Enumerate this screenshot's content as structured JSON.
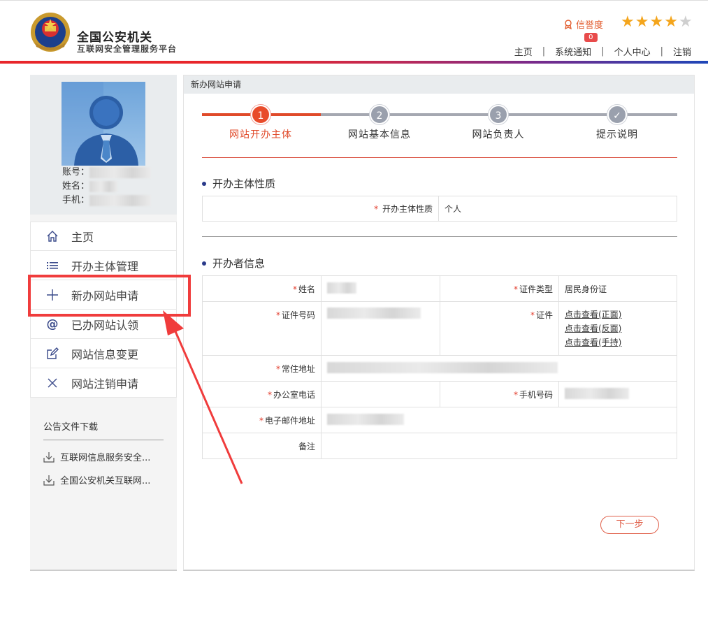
{
  "header": {
    "title": "全国公安机关",
    "subtitle": "互联网安全管理服务平台",
    "credit_label": "信誉度",
    "stars": {
      "filled": 4,
      "total": 5
    },
    "nav": {
      "home": "主页",
      "notifications": "系统通知",
      "notification_count": "0",
      "profile": "个人中心",
      "logout": "注销"
    }
  },
  "sidebar": {
    "profile": {
      "account_label": "账号：",
      "name_label": "姓名：",
      "phone_label": "手机："
    },
    "menu": [
      {
        "label": "主页",
        "icon": "home-icon"
      },
      {
        "label": "开办主体管理",
        "icon": "list-icon"
      },
      {
        "label": "新办网站申请",
        "icon": "plus-icon"
      },
      {
        "label": "已办网站认领",
        "icon": "at-icon"
      },
      {
        "label": "网站信息变更",
        "icon": "edit-icon"
      },
      {
        "label": "网站注销申请",
        "icon": "close-icon"
      }
    ],
    "downloads": {
      "title": "公告文件下载",
      "items": [
        "互联网信息服务安全...",
        "全国公安机关互联网..."
      ]
    }
  },
  "main": {
    "breadcrumb": "新办网站申请",
    "steps": [
      {
        "num": "1",
        "label": "网站开办主体",
        "active": true
      },
      {
        "num": "2",
        "label": "网站基本信息",
        "active": false
      },
      {
        "num": "3",
        "label": "网站负责人",
        "active": false
      },
      {
        "num": "✓",
        "label": "提示说明",
        "active": false
      }
    ],
    "entity_section": {
      "title": "开办主体性质",
      "label": "开办主体性质",
      "value": "个人"
    },
    "owner_section": {
      "title": "开办者信息",
      "name_label": "姓名",
      "id_type_label": "证件类型",
      "id_type_value": "居民身份证",
      "id_number_label": "证件号码",
      "id_doc_label": "证件",
      "id_links": [
        "点击查看(正面)",
        "点击查看(反面)",
        "点击查看(手持)"
      ],
      "address_label": "常住地址",
      "office_phone_label": "办公室电话",
      "mobile_label": "手机号码",
      "email_label": "电子邮件地址",
      "remarks_label": "备注"
    },
    "next_button": "下一步"
  },
  "colors": {
    "accent_red": "#e04a2a",
    "step_inactive": "#9aa0ad",
    "highlight": "#f03c3c",
    "navy": "#2a3a8a"
  }
}
